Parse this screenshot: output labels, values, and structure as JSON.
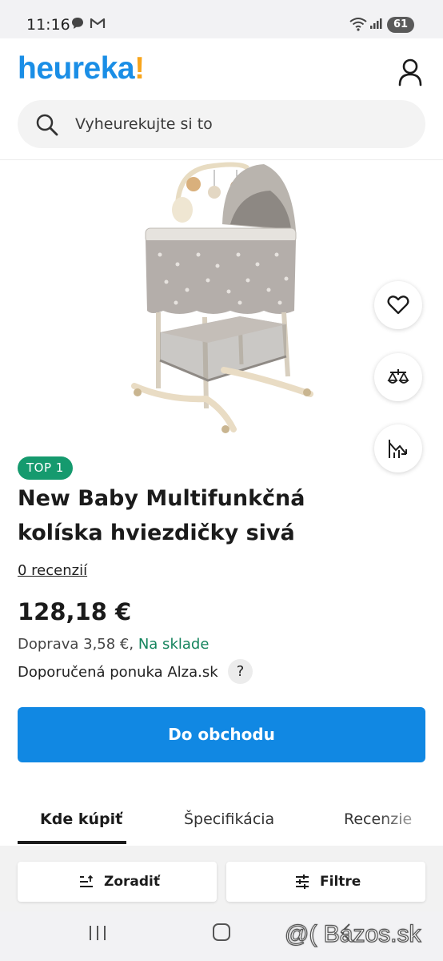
{
  "status_bar": {
    "time": "11:16",
    "battery": "61"
  },
  "header": {
    "logo_main": "heureka",
    "logo_bang": "!",
    "search_placeholder": "Vyheurekujte si to"
  },
  "product": {
    "badge": "TOP 1",
    "title": "New Baby Multifunkčná kolíska hviezdičky sivá",
    "reviews": "0 recenzií",
    "price": "128,18 €",
    "delivery_prefix": "Doprava 3,58 €,",
    "stock": "Na sklade",
    "offer": "Doporučená ponuka Alza.sk",
    "help": "?"
  },
  "cta": {
    "label": "Do obchodu"
  },
  "tabs": [
    {
      "label": "Kde kúpiť",
      "active": true
    },
    {
      "label": "Špecifikácia",
      "active": false
    },
    {
      "label": "Recenzie",
      "active": false
    }
  ],
  "controls": {
    "sort_label": "Zoradiť",
    "filter_label": "Filtre"
  },
  "watermark": "@( Bazos.sk",
  "colors": {
    "brand_blue": "#1a8ee6",
    "brand_orange": "#f8a51c",
    "cta_blue": "#1188e3",
    "badge_green": "#159a6e",
    "stock_green": "#13835c"
  },
  "icons": [
    "heart-icon",
    "compare-icon",
    "price-history-icon",
    "search-icon",
    "user-icon",
    "sort-icon",
    "filter-icon"
  ]
}
